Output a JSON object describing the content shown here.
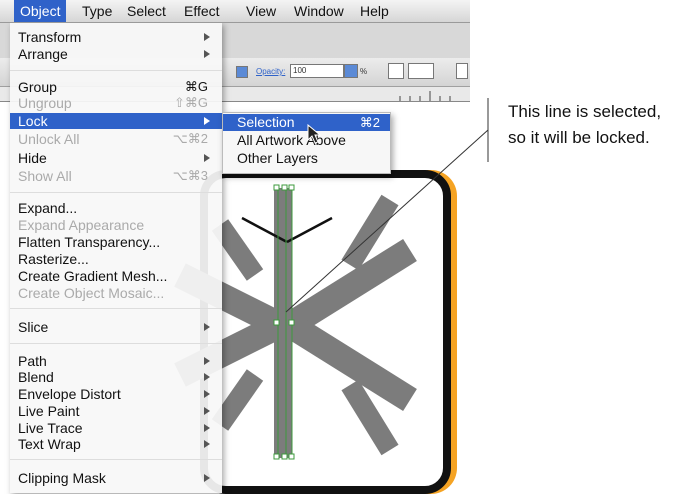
{
  "menubar": {
    "items": [
      {
        "label": "Object"
      },
      {
        "label": "Type"
      },
      {
        "label": "Select"
      },
      {
        "label": "Effect"
      },
      {
        "label": "View"
      },
      {
        "label": "Window"
      },
      {
        "label": "Help"
      }
    ]
  },
  "control_bar": {
    "opacity_label": "Opacity:",
    "opacity_value": "100",
    "percent": "%"
  },
  "object_menu": {
    "items": [
      {
        "label": "Transform",
        "shortcut": ""
      },
      {
        "label": "Arrange",
        "shortcut": ""
      },
      {
        "label": "Group",
        "shortcut": "⌘G"
      },
      {
        "label": "Ungroup",
        "shortcut": "⇧⌘G"
      },
      {
        "label": "Lock",
        "shortcut": ""
      },
      {
        "label": "Unlock All",
        "shortcut": "⌥⌘2"
      },
      {
        "label": "Hide",
        "shortcut": ""
      },
      {
        "label": "Show All",
        "shortcut": "⌥⌘3"
      },
      {
        "label": "Expand...",
        "shortcut": ""
      },
      {
        "label": "Expand Appearance",
        "shortcut": ""
      },
      {
        "label": "Flatten Transparency...",
        "shortcut": ""
      },
      {
        "label": "Rasterize...",
        "shortcut": ""
      },
      {
        "label": "Create Gradient Mesh...",
        "shortcut": ""
      },
      {
        "label": "Create Object Mosaic...",
        "shortcut": ""
      },
      {
        "label": "Slice",
        "shortcut": ""
      },
      {
        "label": "Path",
        "shortcut": ""
      },
      {
        "label": "Blend",
        "shortcut": ""
      },
      {
        "label": "Envelope Distort",
        "shortcut": ""
      },
      {
        "label": "Live Paint",
        "shortcut": ""
      },
      {
        "label": "Live Trace",
        "shortcut": ""
      },
      {
        "label": "Text Wrap",
        "shortcut": ""
      },
      {
        "label": "Clipping Mask",
        "shortcut": ""
      }
    ]
  },
  "lock_submenu": {
    "items": [
      {
        "label": "Selection",
        "shortcut": "⌘2"
      },
      {
        "label": "All Artwork Above",
        "shortcut": ""
      },
      {
        "label": "Other Layers",
        "shortcut": ""
      }
    ]
  },
  "callout": {
    "line1": "This line is selected,",
    "line2": "so it will be locked."
  },
  "colors": {
    "highlight": "#2f62c9",
    "frame_orange": "#f5a323",
    "selection_green": "#3c9a3c",
    "snowflake_gray": "#7c7c7c"
  }
}
